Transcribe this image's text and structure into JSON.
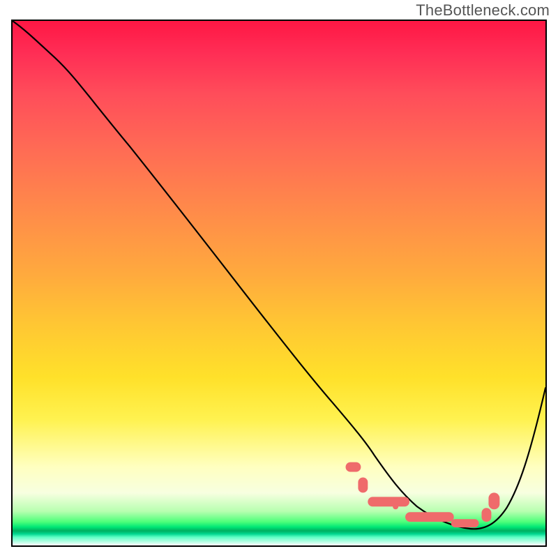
{
  "watermark": "TheBottleneck.com",
  "chart_data": {
    "type": "line",
    "title": "",
    "xlabel": "",
    "ylabel": "",
    "xlim": [
      0,
      100
    ],
    "ylim": [
      0,
      100
    ],
    "grid": false,
    "legend": false,
    "background": {
      "kind": "vertical-gradient",
      "stops": [
        {
          "pos": 0.0,
          "color": "#ff1744"
        },
        {
          "pos": 0.14,
          "color": "#ff4d5a"
        },
        {
          "pos": 0.36,
          "color": "#ff8a4a"
        },
        {
          "pos": 0.58,
          "color": "#ffc733"
        },
        {
          "pos": 0.76,
          "color": "#fff250"
        },
        {
          "pos": 0.9,
          "color": "#f7ffe0"
        },
        {
          "pos": 0.955,
          "color": "#4dff7a"
        },
        {
          "pos": 0.972,
          "color": "#00b060"
        },
        {
          "pos": 1.0,
          "color": "#ffffff"
        }
      ]
    },
    "series": [
      {
        "name": "bottleneck-curve",
        "x": [
          0,
          3,
          8,
          14,
          22,
          30,
          38,
          46,
          54,
          60,
          64,
          68,
          72,
          76,
          80,
          84,
          88,
          92,
          96,
          100
        ],
        "y": [
          100,
          98,
          93,
          86,
          76,
          66,
          56,
          46,
          36,
          28,
          22,
          17,
          12,
          8,
          5,
          3,
          3,
          6,
          15,
          30
        ]
      }
    ],
    "markers": {
      "description": "highlighted minimum region (rounded salmon bars & dots along curve near y≈3-8)",
      "color": "#ef6b6b",
      "segments": [
        {
          "x_start": 63,
          "x_end": 66
        },
        {
          "x_start": 67,
          "x_end": 74
        },
        {
          "x_start": 74,
          "x_end": 82
        },
        {
          "x_start": 85,
          "x_end": 90
        }
      ],
      "dots": [
        {
          "x": 63
        },
        {
          "x": 66
        },
        {
          "x": 70
        },
        {
          "x": 74
        },
        {
          "x": 78
        },
        {
          "x": 82
        },
        {
          "x": 86
        },
        {
          "x": 89
        }
      ]
    }
  }
}
